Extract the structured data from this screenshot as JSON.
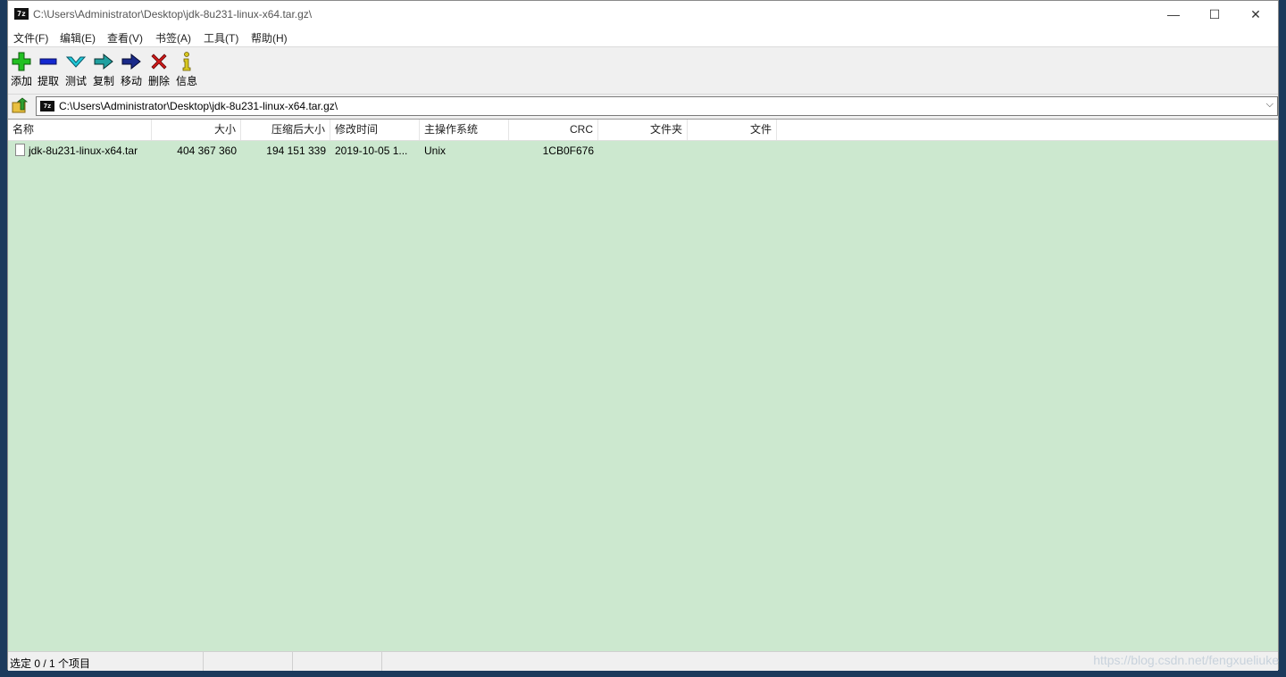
{
  "window": {
    "title": "C:\\Users\\Administrator\\Desktop\\jdk-8u231-linux-x64.tar.gz\\",
    "app_icon_text": "7z",
    "minimize": "—",
    "maximize": "☐",
    "close": "✕"
  },
  "menu": [
    {
      "label": "文件(F)"
    },
    {
      "label": "编辑(E)"
    },
    {
      "label": "查看(V)"
    },
    {
      "label": "书签(A)"
    },
    {
      "label": "工具(T)"
    },
    {
      "label": "帮助(H)"
    }
  ],
  "toolbar": [
    {
      "label": "添加",
      "icon": "add-icon",
      "color": "#22c022"
    },
    {
      "label": "提取",
      "icon": "extract-icon",
      "color": "#1428d0"
    },
    {
      "label": "测试",
      "icon": "test-icon",
      "color": "#20b8c8"
    },
    {
      "label": "复制",
      "icon": "copy-icon",
      "color": "#208080"
    },
    {
      "label": "移动",
      "icon": "move-icon",
      "color": "#1a2a8a"
    },
    {
      "label": "删除",
      "icon": "delete-icon",
      "color": "#d01818"
    },
    {
      "label": "信息",
      "icon": "info-icon",
      "color": "#d8c820"
    }
  ],
  "path": {
    "value": "C:\\Users\\Administrator\\Desktop\\jdk-8u231-linux-x64.tar.gz\\",
    "icon_text": "7z"
  },
  "columns": [
    "名称",
    "大小",
    "压缩后大小",
    "修改时间",
    "主操作系统",
    "CRC",
    "文件夹",
    "文件"
  ],
  "rows": [
    {
      "name": "jdk-8u231-linux-x64.tar",
      "size": "404 367 360",
      "packed": "194 151 339",
      "modified": "2019-10-05 1...",
      "host_os": "Unix",
      "crc": "1CB0F676",
      "folders": "",
      "files": ""
    }
  ],
  "status": {
    "selection": "选定 0 / 1 个项目",
    "seg2": "",
    "seg3": ""
  },
  "watermark": "https://blog.csdn.net/fengxueliuke",
  "colors": {
    "list_bg": "#cce8cf",
    "chrome_bg": "#f0f0f0"
  }
}
